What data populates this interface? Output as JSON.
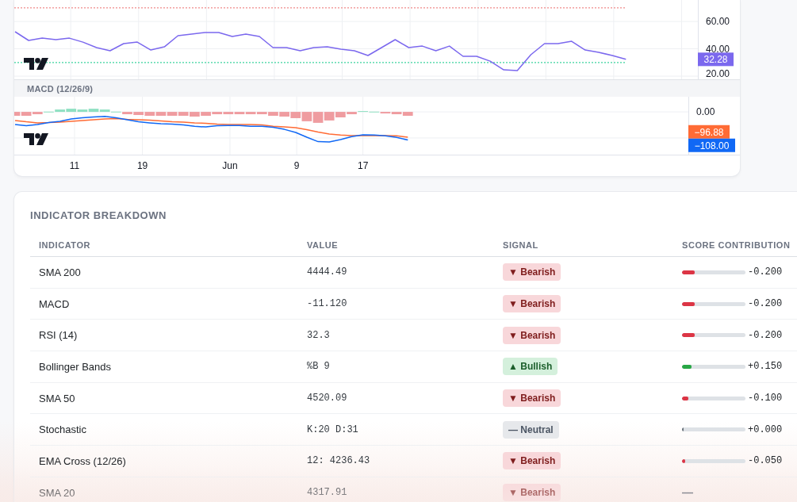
{
  "rsi_pane": {
    "chart_data": {
      "type": "line",
      "categories": [
        null,
        null,
        null,
        null,
        null,
        null,
        null,
        null,
        null,
        null,
        null,
        null,
        null,
        null,
        null,
        null,
        null,
        null,
        null,
        null,
        null,
        null,
        null,
        null,
        null,
        null,
        null,
        null,
        null,
        null,
        null,
        null,
        null,
        null,
        null,
        null,
        null,
        null,
        null,
        null,
        null,
        null,
        null,
        null,
        null,
        null
      ],
      "ylim": [
        17.7,
        75.7
      ],
      "yticks": [
        {
          "value": 60,
          "label": "60.00"
        },
        {
          "value": 40,
          "label": "40.00"
        },
        {
          "value": 20,
          "label": "20.00"
        }
      ],
      "grid": true,
      "series": [
        {
          "color": "#7b68ee",
          "values": [
            52.5,
            46.1,
            47.8,
            46.7,
            47.8,
            44.9,
            40.9,
            38.6,
            43.8,
            44.9,
            39.1,
            41.4,
            49.6,
            50.7,
            51.9,
            51.9,
            49.0,
            50.7,
            49.0,
            40.9,
            40.9,
            38.6,
            40.9,
            41.4,
            39.7,
            38.6,
            35.1,
            40.9,
            46.7,
            40.9,
            42.0,
            38.6,
            42.0,
            34.5,
            34.5,
            31.0,
            24.6,
            24.1,
            35.7,
            43.8,
            43.8,
            45.5,
            39.1,
            37.4,
            35.1,
            32.3
          ]
        }
      ],
      "ref_lines": [
        {
          "axis": "y",
          "value": 70,
          "color": "#f08a8a"
        },
        {
          "axis": "y",
          "value": 30,
          "color": "#3cd39f"
        }
      ],
      "annotations": [
        "32.28"
      ]
    }
  },
  "macd_pane": {
    "title": "MACD (12/26/9)",
    "zero_label": "0.00",
    "price_labels": [
      {
        "text": "−96.88",
        "color": "#ff6b35"
      },
      {
        "text": "−108.00",
        "color": "#1068f5"
      }
    ],
    "time_labels": [
      "11",
      "19",
      "Jun",
      "9",
      "17"
    ]
  },
  "breakdown": {
    "title": "INDICATOR BREAKDOWN",
    "columns": [
      "INDICATOR",
      "VALUE",
      "SIGNAL",
      "SCORE CONTRIBUTION"
    ],
    "rows": [
      {
        "indicator": "SMA 200",
        "value": "4444.49",
        "signal": {
          "kind": "bearish",
          "label": "▼ Bearish"
        },
        "score": {
          "kind": "bar",
          "level": 0.2,
          "color": "#dc3545",
          "reading": "-0.200"
        }
      },
      {
        "indicator": "MACD",
        "value": "-11.120",
        "signal": {
          "kind": "bearish",
          "label": "▼ Bearish"
        },
        "score": {
          "kind": "bar",
          "level": 0.2,
          "color": "#dc3545",
          "reading": "-0.200"
        }
      },
      {
        "indicator": "RSI (14)",
        "value": "32.3",
        "signal": {
          "kind": "bearish",
          "label": "▼ Bearish"
        },
        "score": {
          "kind": "bar",
          "level": 0.2,
          "color": "#dc3545",
          "reading": "-0.200"
        }
      },
      {
        "indicator": "Bollinger Bands",
        "value": "%B 9",
        "signal": {
          "kind": "bullish",
          "label": "▲ Bullish"
        },
        "score": {
          "kind": "bar",
          "level": 0.15,
          "color": "#28a745",
          "reading": "+0.150"
        }
      },
      {
        "indicator": "SMA 50",
        "value": "4520.09",
        "signal": {
          "kind": "bearish",
          "label": "▼ Bearish"
        },
        "score": {
          "kind": "bar",
          "level": 0.1,
          "color": "#dc3545",
          "reading": "-0.100"
        }
      },
      {
        "indicator": "Stochastic",
        "value": "K:20 D:31",
        "signal": {
          "kind": "neutral",
          "label": "— Neutral"
        },
        "score": {
          "kind": "bar",
          "level": 0,
          "color": "#6c757d",
          "reading": "+0.000"
        }
      },
      {
        "indicator": "EMA Cross (12/26)",
        "value": "12: 4236.43",
        "signal": {
          "kind": "bearish",
          "label": "▼ Bearish"
        },
        "score": {
          "kind": "bar",
          "level": 0.05,
          "color": "#dc3545",
          "reading": "-0.050"
        }
      },
      {
        "indicator": "SMA 20",
        "value": "4317.91",
        "signal": {
          "kind": "bearish",
          "label": "▼ Bearish"
        },
        "score": {
          "kind": "dash",
          "text": "—"
        }
      }
    ]
  }
}
